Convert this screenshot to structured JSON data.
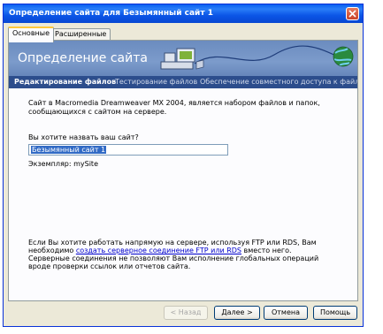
{
  "window": {
    "title": "Определение сайта для Безымянный сайт 1",
    "close_icon": "close-icon"
  },
  "tabs": [
    {
      "label": "Основные",
      "active": true
    },
    {
      "label": "Расширенные",
      "active": false
    }
  ],
  "banner": {
    "title": "Определение сайта"
  },
  "nav": [
    {
      "label": "Редактирование файлов",
      "active": true
    },
    {
      "label": "Тестирование файлов",
      "active": false
    },
    {
      "label": "Обеспечение совместного доступа к файлам",
      "active": false
    }
  ],
  "content": {
    "intro": "Сайт в Macromedia Dreamweaver MX 2004, является набором файлов и папок, сообщающихся с сайтом на сервере.",
    "question": "Вы хотите назвать ваш сайт?",
    "site_name_value": "Безымянный сайт 1",
    "instance_example": "Экземпляр: mySite",
    "server_text_before": "Если Вы хотите работать напрямую на сервере, используя FTP или RDS, Вам необходимо",
    "server_link": "создать серверное соединение FTP или RDS",
    "server_text_after": "вместо него. Серверные соединения не позволяют Вам исполнение глобальных операций вроде проверки ссылок или отчетов сайта."
  },
  "buttons": {
    "back": "< Назад",
    "next": "Далее >",
    "cancel": "Отмена",
    "help": "Помощь"
  },
  "colors": {
    "titlebar": "#0a5ff0",
    "banner": "#7c9bcb",
    "navbar": "#2c4d8c",
    "link": "#0000cc",
    "selection": "#316ac5"
  }
}
